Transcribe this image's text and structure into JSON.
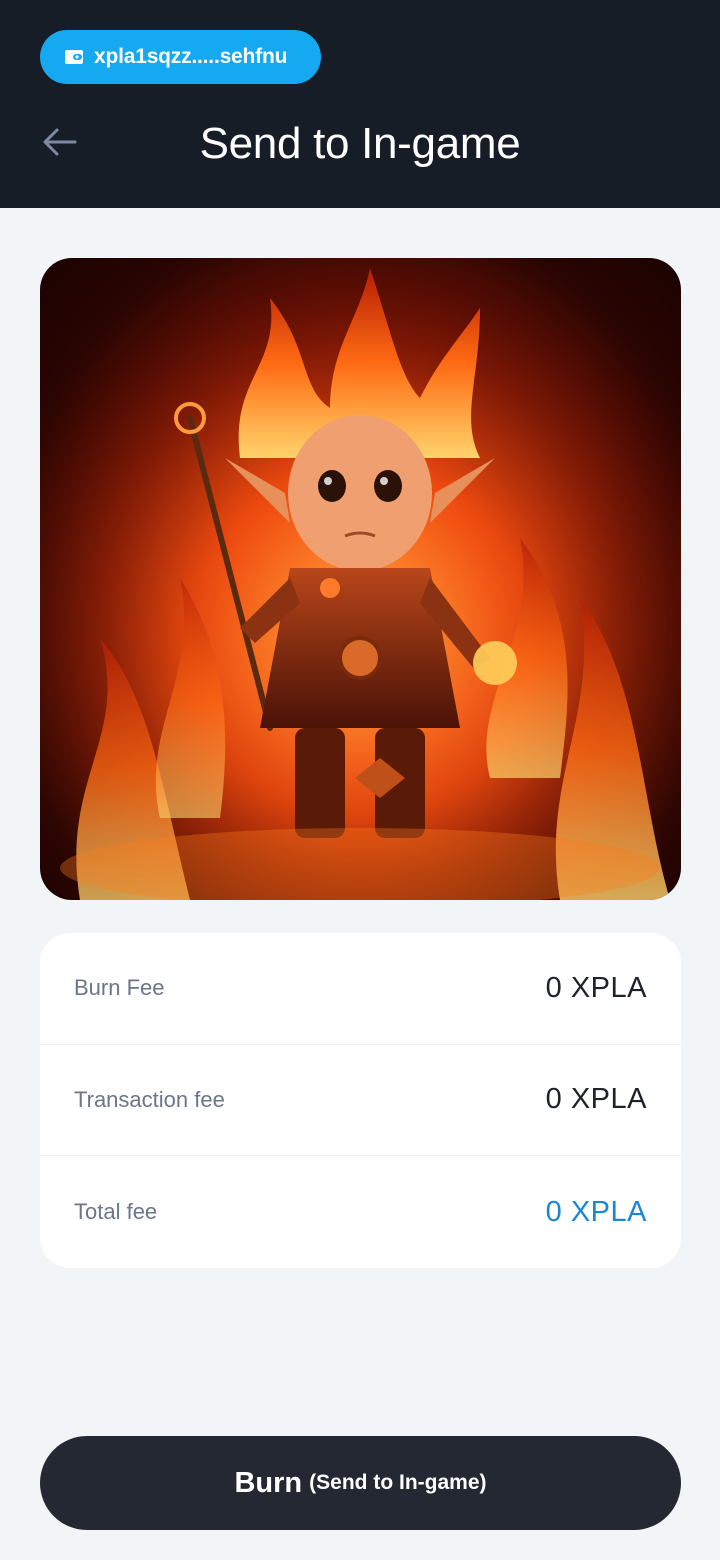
{
  "header": {
    "wallet_address": "xpla1sqzz.....sehfnu",
    "title": "Send to In-game",
    "back_icon": "arrow-left-icon",
    "wallet_icon": "wallet-icon",
    "background": "#171d27",
    "pill_color": "#14a9f0"
  },
  "nft": {
    "image": "fire-elf-character-artwork"
  },
  "fees": [
    {
      "label": "Burn Fee",
      "value": "0 XPLA"
    },
    {
      "label": "Transaction fee",
      "value": "0 XPLA"
    },
    {
      "label": "Total fee",
      "value": "0 XPLA"
    }
  ],
  "accent_color": "#1a86db",
  "action": {
    "main_label": "Burn",
    "sub_label": "(Send to In-game)"
  }
}
